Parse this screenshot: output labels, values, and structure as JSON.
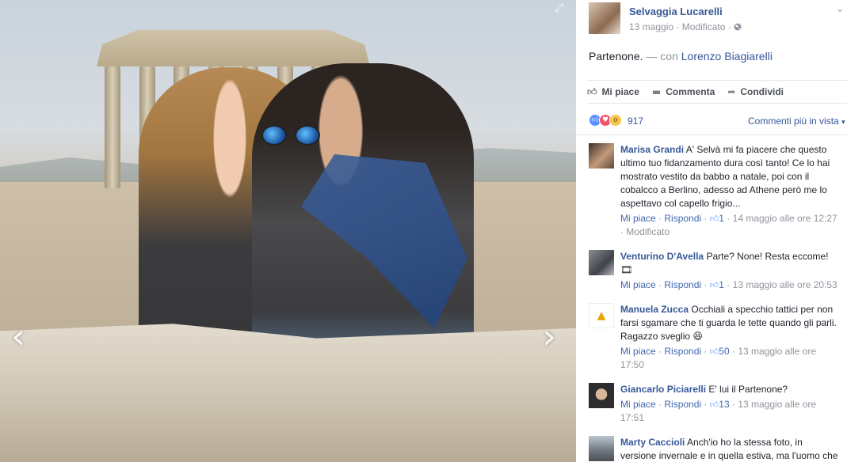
{
  "photo": {
    "prev_arrow": "‹",
    "next_arrow": "›",
    "expand_icon": "⤢"
  },
  "post": {
    "author": "Selvaggia Lucarelli",
    "date": "13 maggio",
    "separator": "·",
    "edited": "Modificato",
    "audience_icon": "globe-icon",
    "caption_text": "Partenone.",
    "caption_with": "— con",
    "caption_tag": "Lorenzo Biagiarelli"
  },
  "actions": {
    "like": "Mi piace",
    "comment": "Commenta",
    "share": "Condividi"
  },
  "reactions": {
    "count": "917",
    "relevance": "Commenti più in vista"
  },
  "comments": [
    {
      "name": "Marisa Grandi",
      "text": "A' Selvà mi fa piacere che questo ultimo tuo fidanzamento dura così tanto! Ce lo hai mostrato vestito da babbo a natale, poi con il cobalcco a Berlino, adesso ad Athene però me lo aspettavo col capello frigio...",
      "like_label": "Mi piace",
      "reply_label": "Rispondi",
      "likes": "1",
      "time": "14 maggio alle ore 12:27",
      "edited": "Modificato",
      "sep": "·"
    },
    {
      "name": "Venturino D'Avella",
      "text": "Parte? None! Resta eccome!",
      "extra": "🎞",
      "like_label": "Mi piace",
      "reply_label": "Rispondi",
      "likes": "1",
      "time": "13 maggio alle ore 20:53",
      "sep": "·"
    },
    {
      "name": "Manuela Zucca",
      "text": "Occhiali a specchio tattici per non farsi sgamare che ti guarda le tette quando gli parli. Ragazzo sveglio",
      "emoji": "😆",
      "like_label": "Mi piace",
      "reply_label": "Rispondi",
      "likes": "50",
      "time": "13 maggio alle ore 17:50",
      "sep": "·"
    },
    {
      "name": "Giancarlo Piciarelli",
      "text": "E' lui il Partenone?",
      "like_label": "Mi piace",
      "reply_label": "Rispondi",
      "likes": "13",
      "time": "13 maggio alle ore 17:51",
      "sep": "·"
    },
    {
      "name": "Marty Caccioli",
      "text": "Anch'io ho la stessa foto, in versione invernale e in quella estiva, ma l'uomo che mi abbraccia non è figo quanto il tuo",
      "emoji": "🙂"
    }
  ],
  "colors": {
    "link": "#365899",
    "meta": "#90949c",
    "action_link": "#4267b2",
    "like_reaction": "#5890ff",
    "love_reaction": "#f25268",
    "wow_reaction": "#f7c64a"
  }
}
